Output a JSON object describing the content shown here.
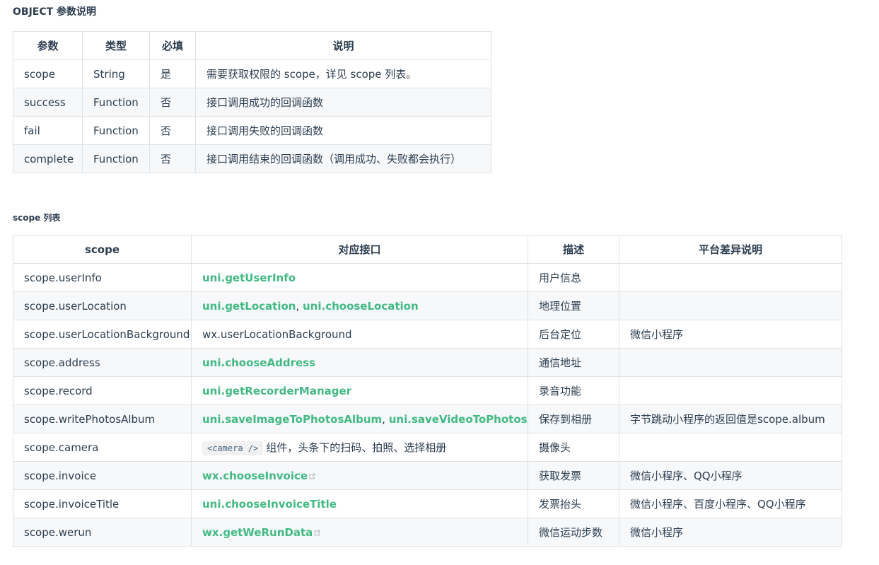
{
  "object_heading": "OBJECT 参数说明",
  "object_table": {
    "headers": [
      "参数",
      "类型",
      "必填",
      "说明"
    ],
    "rows": [
      {
        "param": "scope",
        "type": "String",
        "required": "是",
        "desc": "需要获取权限的 scope，详见 scope 列表。"
      },
      {
        "param": "success",
        "type": "Function",
        "required": "否",
        "desc": "接口调用成功的回调函数"
      },
      {
        "param": "fail",
        "type": "Function",
        "required": "否",
        "desc": "接口调用失败的回调函数"
      },
      {
        "param": "complete",
        "type": "Function",
        "required": "否",
        "desc": "接口调用结束的回调函数（调用成功、失败都会执行）"
      }
    ]
  },
  "scope_heading": "scope 列表",
  "scope_table": {
    "headers": [
      "scope",
      "对应接口",
      "描述",
      "平台差异说明"
    ],
    "rows": [
      {
        "scope": "scope.userInfo",
        "api_links": [
          "uni.getUserInfo"
        ],
        "desc": "用户信息",
        "platform": ""
      },
      {
        "scope": "scope.userLocation",
        "api_links": [
          "uni.getLocation",
          "uni.chooseLocation"
        ],
        "desc": "地理位置",
        "platform": ""
      },
      {
        "scope": "scope.userLocationBackground",
        "api_text": "wx.userLocationBackground",
        "desc": "后台定位",
        "platform": "微信小程序"
      },
      {
        "scope": "scope.address",
        "api_links": [
          "uni.chooseAddress"
        ],
        "desc": "通信地址",
        "platform": ""
      },
      {
        "scope": "scope.record",
        "api_links": [
          "uni.getRecorderManager"
        ],
        "desc": "录音功能",
        "platform": ""
      },
      {
        "scope": "scope.writePhotosAlbum",
        "api_links": [
          "uni.saveImageToPhotosAlbum",
          "uni.saveVideoToPhotosAlbum"
        ],
        "desc": "保存到相册",
        "platform": "字节跳动小程序的返回值是scope.album"
      },
      {
        "scope": "scope.camera",
        "api_code": "<camera />",
        "api_text": "组件，头条下的扫码、拍照、选择相册",
        "desc": "摄像头",
        "platform": ""
      },
      {
        "scope": "scope.invoice",
        "api_links": [
          "wx.chooseInvoice"
        ],
        "external": true,
        "desc": "获取发票",
        "platform": "微信小程序、QQ小程序"
      },
      {
        "scope": "scope.invoiceTitle",
        "api_links": [
          "uni.chooseInvoiceTitle"
        ],
        "desc": "发票抬头",
        "platform": "微信小程序、百度小程序、QQ小程序"
      },
      {
        "scope": "scope.werun",
        "api_links": [
          "wx.getWeRunData"
        ],
        "external": true,
        "desc": "微信运动步数",
        "platform": "微信小程序"
      }
    ]
  },
  "colors": {
    "link": "#42b983",
    "text": "#2c3e50",
    "border": "#dfe2e5",
    "stripe": "#f6f8fa",
    "code_bg": "#f1f1f1"
  },
  "icons": {
    "external": "external-link-icon"
  }
}
